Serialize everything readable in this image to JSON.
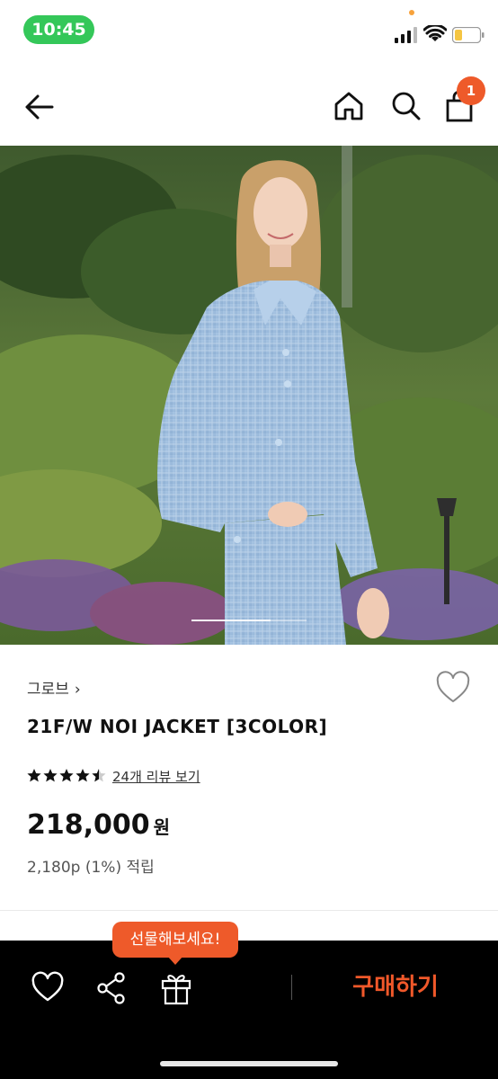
{
  "status_bar": {
    "time": "10:45"
  },
  "nav": {
    "cart_count": "1",
    "icons": [
      "back-arrow-icon",
      "home-icon",
      "search-icon",
      "shopping-bag-icon"
    ]
  },
  "product": {
    "brand": "그로브",
    "brand_chevron": "›",
    "title": "21F/W NOI JACKET [3COLOR]",
    "rating": 4.5,
    "rating_max": 5,
    "review_link": "24개 리뷰 보기",
    "price": "218,000",
    "currency": "원",
    "points": "2,180p (1%) 적립"
  },
  "bottom_bar": {
    "gift_tooltip": "선물해보세요!",
    "buy_label": "구매하기",
    "icons": [
      "heart-icon",
      "share-icon",
      "gift-icon"
    ]
  },
  "colors": {
    "accent": "#ee5a2a",
    "buy_text": "#f0582a",
    "status_green": "#34c759",
    "bottom_bar_bg": "#000000"
  }
}
